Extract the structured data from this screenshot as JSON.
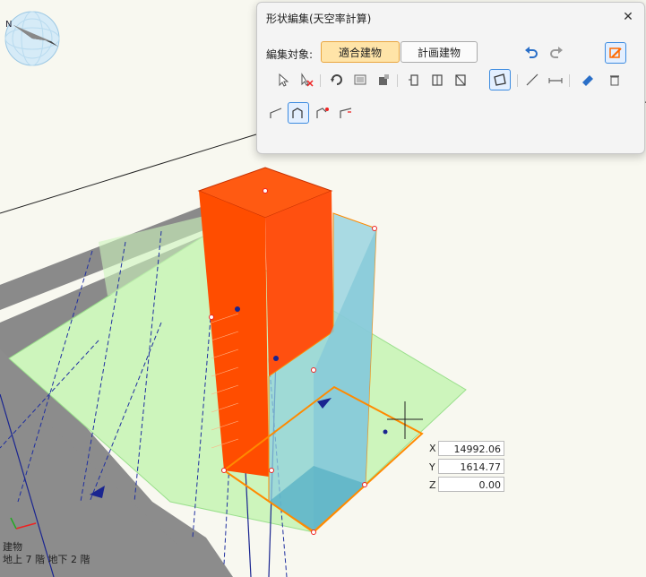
{
  "compass": {
    "north_label": "N"
  },
  "panel": {
    "title": "形状編集(天空率計算)",
    "target_label": "編集対象:",
    "target_options": [
      "適合建物",
      "計画建物"
    ],
    "selected_target": "適合建物"
  },
  "toolbar_icons": [
    "select-arrow-icon",
    "deselect-icon",
    "rotate-view-icon",
    "image-icon",
    "cube-add-icon",
    "extrude-icon",
    "building-icon",
    "slice-icon",
    "edit-face-icon",
    "line-icon",
    "dimension-icon",
    "eraser-icon",
    "trash-icon",
    "undo-icon",
    "redo-icon",
    "settings-icon",
    "slope-a-icon",
    "slope-b-icon",
    "slope-add-icon",
    "slope-edit-icon"
  ],
  "coords": {
    "x_label": "X",
    "x_value": "14992.06",
    "y_label": "Y",
    "y_value": "1614.77",
    "z_label": "Z",
    "z_value": "0.00"
  },
  "status": {
    "line1": "建物",
    "line2": "地上 7 階 地下 2 階"
  },
  "colors": {
    "building_orange": "#ff5a12",
    "building_blue": "#8fd0df",
    "site_green": "#cdf5bc",
    "road_gray": "#878787",
    "outline_orange": "#ff8a00",
    "active_button": "#ffe4a8"
  }
}
